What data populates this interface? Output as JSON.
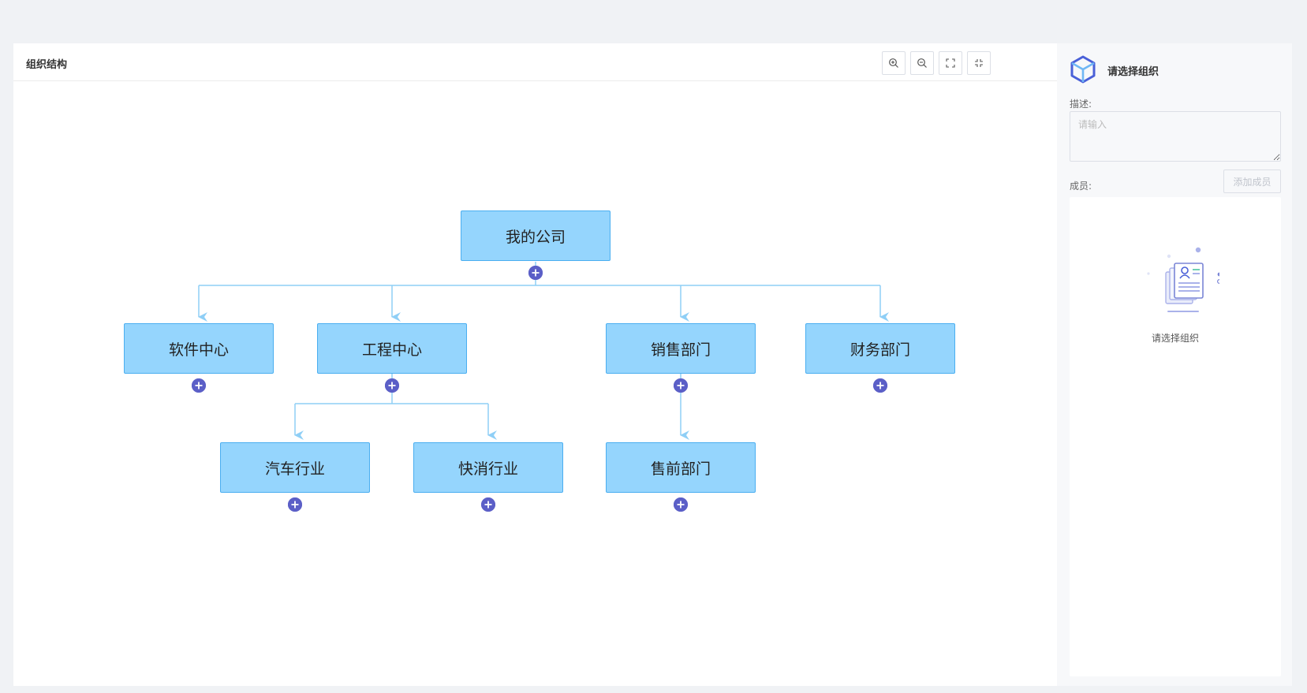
{
  "main": {
    "title": "组织结构",
    "toolbar": [
      {
        "name": "zoom-in-icon"
      },
      {
        "name": "zoom-out-icon"
      },
      {
        "name": "expand-icon"
      },
      {
        "name": "collapse-icon"
      }
    ]
  },
  "org_tree": {
    "root": "我的公司",
    "level1": [
      "软件中心",
      "工程中心",
      "销售部门",
      "财务部门"
    ],
    "level2": [
      "汽车行业",
      "快消行业",
      "售前部门"
    ],
    "add_icon": "plus-circle-icon"
  },
  "side": {
    "icon": "cube-icon",
    "title": "请选择组织",
    "desc_label": "描述:",
    "desc_placeholder": "请输入",
    "members_label": "成员:",
    "add_member_label": "添加成员",
    "empty_text": "请选择组织",
    "empty_icon": "document-list-icon"
  },
  "colors": {
    "node_fill": "#95d5fd",
    "node_border": "#4aaef0",
    "link": "#8fcff6",
    "add_button": "#5b5fc7"
  }
}
